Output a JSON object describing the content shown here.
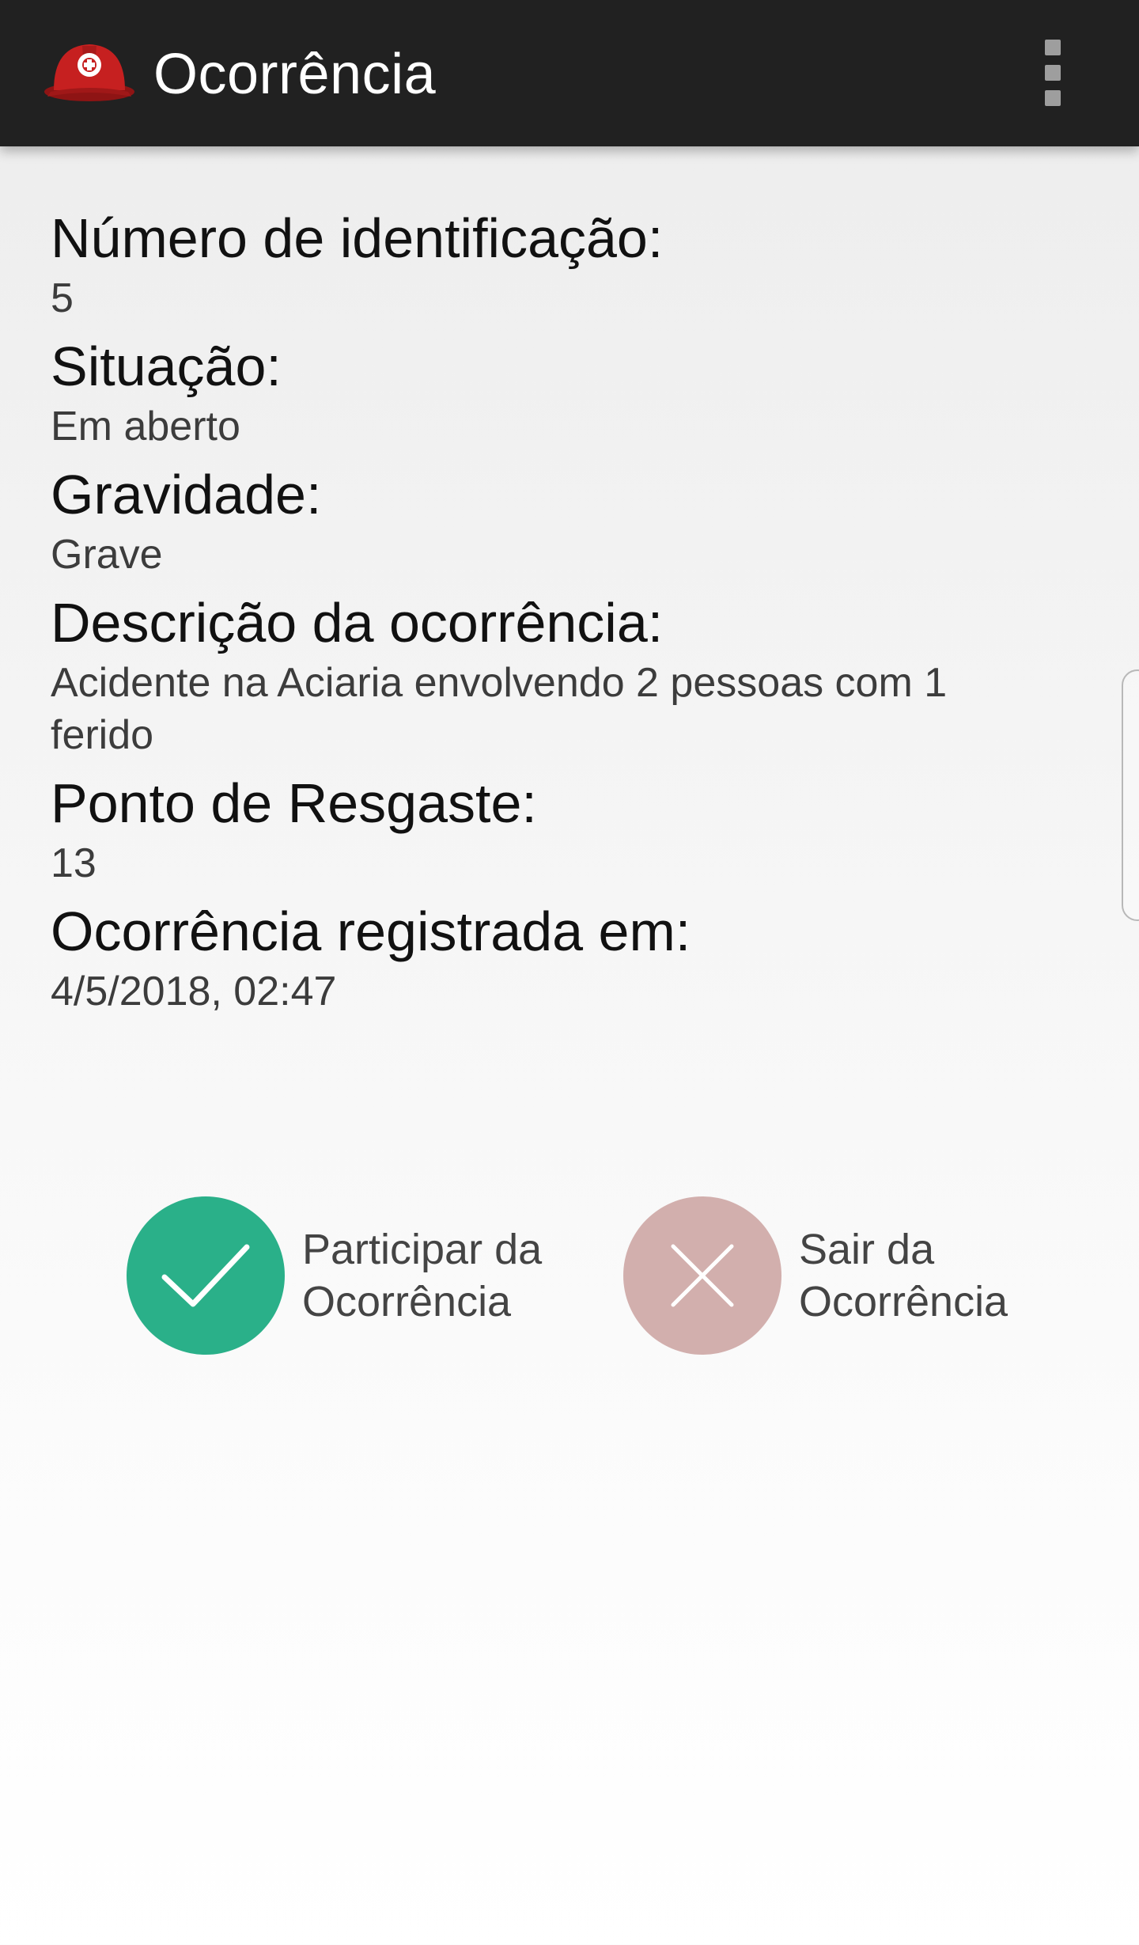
{
  "appbar": {
    "title": "Ocorrência",
    "logo_icon": "firefighter-helmet-icon",
    "menu_icon": "more-vert-icon"
  },
  "details": [
    {
      "label": "Número de identificação:",
      "value": "5"
    },
    {
      "label": "Situação:",
      "value": "Em aberto"
    },
    {
      "label": "Gravidade:",
      "value": "Grave"
    },
    {
      "label": "Descrição da ocorrência:",
      "value": "Acidente na Aciaria envolvendo 2 pessoas com 1 ferido"
    },
    {
      "label": "Ponto de Resgaste:",
      "value": "13"
    },
    {
      "label": "Ocorrência registrada em:",
      "value": "4/5/2018, 02:47"
    }
  ],
  "actions": {
    "participate": {
      "label": "Participar da Ocorrência",
      "icon": "check-icon",
      "color": "#2ab089"
    },
    "leave": {
      "label": "Sair da Ocorrência",
      "icon": "close-icon",
      "color": "#d2afad"
    }
  },
  "colors": {
    "appbar_background": "#212121",
    "helmet_red": "#c62020"
  }
}
